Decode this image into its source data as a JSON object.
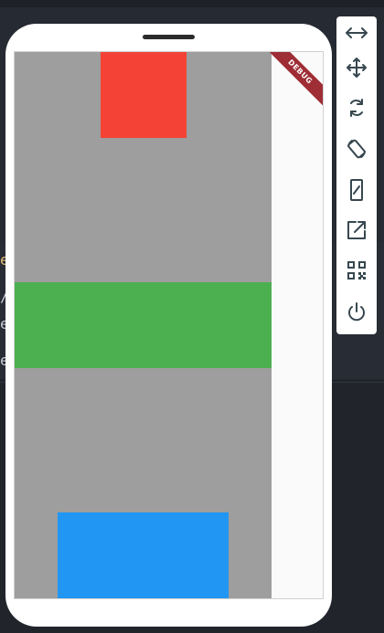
{
  "app": {
    "debug_banner": "DEBUG"
  },
  "editor_fragments": [
    "e",
    "/",
    "e",
    "e"
  ],
  "colors": {
    "gray": "#9e9e9e",
    "red": "#f44336",
    "green": "#4caf50",
    "blue": "#2196f3",
    "toolbar_icon": "#37474f"
  },
  "toolbar": {
    "items": [
      {
        "icon": "resize-horizontal-icon"
      },
      {
        "icon": "move-icon"
      },
      {
        "icon": "rotate-icon"
      },
      {
        "icon": "screen-rotation-icon"
      },
      {
        "icon": "device-frame-icon"
      },
      {
        "icon": "open-external-icon"
      },
      {
        "icon": "qr-code-icon"
      },
      {
        "icon": "power-icon"
      }
    ]
  }
}
